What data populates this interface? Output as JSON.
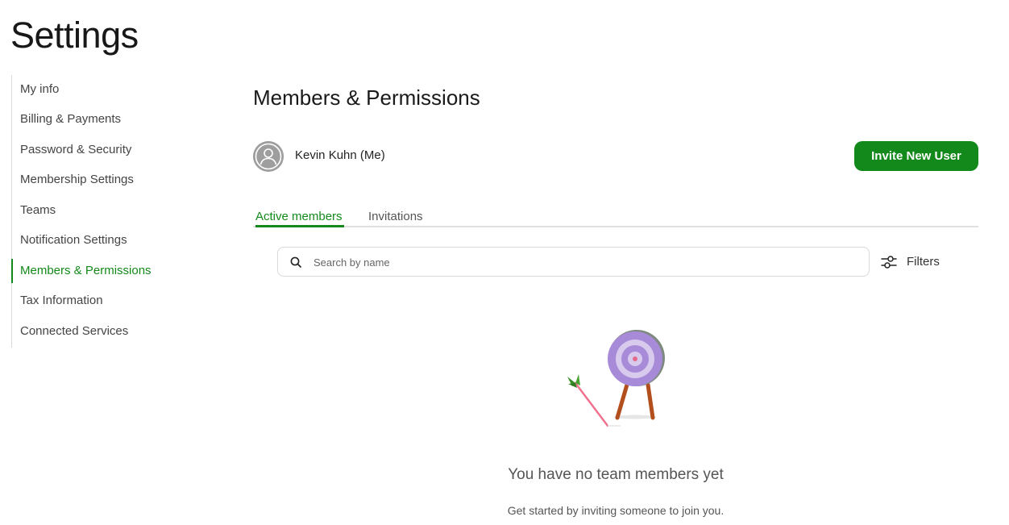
{
  "page": {
    "title": "Settings"
  },
  "sidebar": {
    "items": [
      {
        "label": "My info"
      },
      {
        "label": "Billing & Payments"
      },
      {
        "label": "Password & Security"
      },
      {
        "label": "Membership Settings"
      },
      {
        "label": "Teams"
      },
      {
        "label": "Notification Settings"
      },
      {
        "label": "Members & Permissions",
        "active": true
      },
      {
        "label": "Tax Information"
      },
      {
        "label": "Connected Services"
      }
    ]
  },
  "main": {
    "title": "Members & Permissions",
    "current_user": {
      "name": "Kevin Kuhn (Me)",
      "avatar_icon": "user-avatar-icon"
    },
    "invite_button": {
      "label": "Invite New User"
    },
    "tabs": [
      {
        "label": "Active members",
        "active": true
      },
      {
        "label": "Invitations",
        "active": false
      }
    ],
    "search": {
      "placeholder": "Search by name",
      "value": "",
      "icon": "search-icon"
    },
    "filters": {
      "label": "Filters",
      "icon": "sliders-icon"
    },
    "empty_state": {
      "illustration": "target-with-arrow-illustration",
      "title": "You have no team members yet",
      "subtitle": "Get started by inviting someone to join you."
    }
  },
  "colors": {
    "accent": "#14891b",
    "text": "#1f1f1f",
    "muted": "#555555",
    "border": "#d9d9d9",
    "target": "#a78bd8"
  }
}
